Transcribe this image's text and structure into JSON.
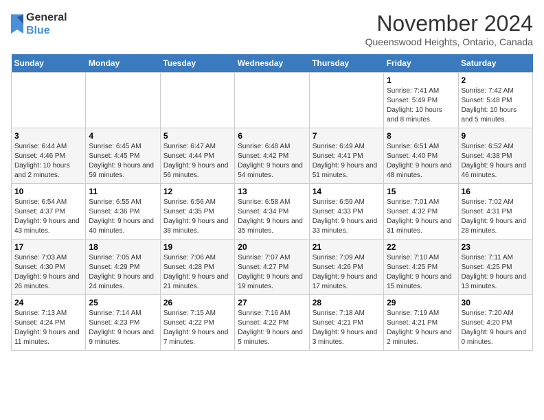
{
  "logo": {
    "line1": "General",
    "line2": "Blue"
  },
  "title": "November 2024",
  "location": "Queenswood Heights, Ontario, Canada",
  "weekdays": [
    "Sunday",
    "Monday",
    "Tuesday",
    "Wednesday",
    "Thursday",
    "Friday",
    "Saturday"
  ],
  "weeks": [
    [
      {
        "day": "",
        "info": ""
      },
      {
        "day": "",
        "info": ""
      },
      {
        "day": "",
        "info": ""
      },
      {
        "day": "",
        "info": ""
      },
      {
        "day": "",
        "info": ""
      },
      {
        "day": "1",
        "info": "Sunrise: 7:41 AM\nSunset: 5:49 PM\nDaylight: 10 hours and 8 minutes."
      },
      {
        "day": "2",
        "info": "Sunrise: 7:42 AM\nSunset: 5:48 PM\nDaylight: 10 hours and 5 minutes."
      }
    ],
    [
      {
        "day": "3",
        "info": "Sunrise: 6:44 AM\nSunset: 4:46 PM\nDaylight: 10 hours and 2 minutes."
      },
      {
        "day": "4",
        "info": "Sunrise: 6:45 AM\nSunset: 4:45 PM\nDaylight: 9 hours and 59 minutes."
      },
      {
        "day": "5",
        "info": "Sunrise: 6:47 AM\nSunset: 4:44 PM\nDaylight: 9 hours and 56 minutes."
      },
      {
        "day": "6",
        "info": "Sunrise: 6:48 AM\nSunset: 4:42 PM\nDaylight: 9 hours and 54 minutes."
      },
      {
        "day": "7",
        "info": "Sunrise: 6:49 AM\nSunset: 4:41 PM\nDaylight: 9 hours and 51 minutes."
      },
      {
        "day": "8",
        "info": "Sunrise: 6:51 AM\nSunset: 4:40 PM\nDaylight: 9 hours and 48 minutes."
      },
      {
        "day": "9",
        "info": "Sunrise: 6:52 AM\nSunset: 4:38 PM\nDaylight: 9 hours and 46 minutes."
      }
    ],
    [
      {
        "day": "10",
        "info": "Sunrise: 6:54 AM\nSunset: 4:37 PM\nDaylight: 9 hours and 43 minutes."
      },
      {
        "day": "11",
        "info": "Sunrise: 6:55 AM\nSunset: 4:36 PM\nDaylight: 9 hours and 40 minutes."
      },
      {
        "day": "12",
        "info": "Sunrise: 6:56 AM\nSunset: 4:35 PM\nDaylight: 9 hours and 38 minutes."
      },
      {
        "day": "13",
        "info": "Sunrise: 6:58 AM\nSunset: 4:34 PM\nDaylight: 9 hours and 35 minutes."
      },
      {
        "day": "14",
        "info": "Sunrise: 6:59 AM\nSunset: 4:33 PM\nDaylight: 9 hours and 33 minutes."
      },
      {
        "day": "15",
        "info": "Sunrise: 7:01 AM\nSunset: 4:32 PM\nDaylight: 9 hours and 31 minutes."
      },
      {
        "day": "16",
        "info": "Sunrise: 7:02 AM\nSunset: 4:31 PM\nDaylight: 9 hours and 28 minutes."
      }
    ],
    [
      {
        "day": "17",
        "info": "Sunrise: 7:03 AM\nSunset: 4:30 PM\nDaylight: 9 hours and 26 minutes."
      },
      {
        "day": "18",
        "info": "Sunrise: 7:05 AM\nSunset: 4:29 PM\nDaylight: 9 hours and 24 minutes."
      },
      {
        "day": "19",
        "info": "Sunrise: 7:06 AM\nSunset: 4:28 PM\nDaylight: 9 hours and 21 minutes."
      },
      {
        "day": "20",
        "info": "Sunrise: 7:07 AM\nSunset: 4:27 PM\nDaylight: 9 hours and 19 minutes."
      },
      {
        "day": "21",
        "info": "Sunrise: 7:09 AM\nSunset: 4:26 PM\nDaylight: 9 hours and 17 minutes."
      },
      {
        "day": "22",
        "info": "Sunrise: 7:10 AM\nSunset: 4:25 PM\nDaylight: 9 hours and 15 minutes."
      },
      {
        "day": "23",
        "info": "Sunrise: 7:11 AM\nSunset: 4:25 PM\nDaylight: 9 hours and 13 minutes."
      }
    ],
    [
      {
        "day": "24",
        "info": "Sunrise: 7:13 AM\nSunset: 4:24 PM\nDaylight: 9 hours and 11 minutes."
      },
      {
        "day": "25",
        "info": "Sunrise: 7:14 AM\nSunset: 4:23 PM\nDaylight: 9 hours and 9 minutes."
      },
      {
        "day": "26",
        "info": "Sunrise: 7:15 AM\nSunset: 4:22 PM\nDaylight: 9 hours and 7 minutes."
      },
      {
        "day": "27",
        "info": "Sunrise: 7:16 AM\nSunset: 4:22 PM\nDaylight: 9 hours and 5 minutes."
      },
      {
        "day": "28",
        "info": "Sunrise: 7:18 AM\nSunset: 4:21 PM\nDaylight: 9 hours and 3 minutes."
      },
      {
        "day": "29",
        "info": "Sunrise: 7:19 AM\nSunset: 4:21 PM\nDaylight: 9 hours and 2 minutes."
      },
      {
        "day": "30",
        "info": "Sunrise: 7:20 AM\nSunset: 4:20 PM\nDaylight: 9 hours and 0 minutes."
      }
    ]
  ]
}
